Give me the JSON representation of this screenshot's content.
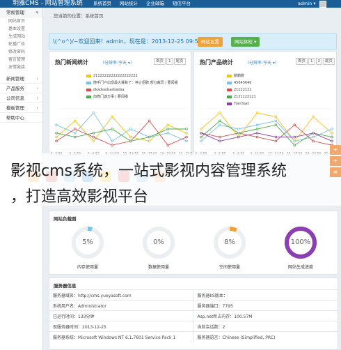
{
  "header": {
    "logo": "玥雅CMS - 网站管理系统",
    "nav": [
      "系统首页",
      "网站统计",
      "企业邮箱",
      "短信平台"
    ],
    "user": "admin ▾"
  },
  "sidebar": {
    "groups": [
      {
        "label": "常规管理",
        "active": true,
        "items": [
          "网站首页",
          "基本设置",
          "生成网站",
          "轮播广告",
          "修改密码",
          "留言管理",
          "友情链接"
        ]
      },
      {
        "label": "新闻管理"
      },
      {
        "label": "产品服务"
      },
      {
        "label": "公司信息"
      },
      {
        "label": "模板管理"
      },
      {
        "label": "帮助中心"
      }
    ]
  },
  "breadcrumb": "您当前的位置：系统首页",
  "welcome": {
    "text": "\\(^o^)/~欢迎回来！admin，现在是：2013-12-25 09:56",
    "settings_button": "网站设置",
    "check_button": "网站体检 ▾"
  },
  "news_panel": {
    "title": "热门新闻统计",
    "sub": "（分辨率:今天 ▾）",
    "pager": [
      "首页",
      "1",
      "尾页"
    ]
  },
  "product_panel": {
    "title": "热门产品统计",
    "sub": "（分辨率:今天 ▾）",
    "pager": [
      "首页",
      "1",
      "2",
      "尾页"
    ]
  },
  "chart_data": [
    {
      "type": "line",
      "categories": [
        "0~3:59",
        "3~5:59",
        "6~8:59",
        "9~11:59",
        "12~14:59",
        "15~17:59",
        "18~20:59",
        "21~23:59"
      ],
      "ylim": [
        0,
        10
      ],
      "series": [
        {
          "name": "21122222222222222222",
          "color": "#f0c419",
          "values": [
            3,
            7,
            2,
            8,
            3,
            2,
            6,
            4
          ]
        },
        {
          "name": "随手门户出现最大暴跌了：停止招聘 部分裁员 | 要闻播",
          "color": "#7cc0e8",
          "values": [
            6,
            4,
            9,
            2,
            5,
            3,
            4,
            2
          ]
        },
        {
          "name": "dkadsadsadsadsa",
          "color": "#d94b4b",
          "values": [
            2,
            5,
            3,
            1,
            2,
            7,
            1,
            3
          ]
        },
        {
          "name": "加微门诚万事 | 要闻播",
          "color": "#4aa84a",
          "values": [
            4,
            3,
            4,
            5,
            2,
            3,
            5,
            5
          ]
        }
      ]
    },
    {
      "type": "line",
      "categories": [
        "0~3:59",
        "3~5:59",
        "6~8:59",
        "9~11:59",
        "12~14:59",
        "15~17:59",
        "18~20:59",
        "21~23:59"
      ],
      "ylim": [
        0,
        10
      ],
      "series": [
        {
          "name": "鹏鹏鹏",
          "color": "#f0c419",
          "values": [
            5,
            9,
            3,
            9,
            8,
            2,
            8,
            4
          ]
        },
        {
          "name": "45645646",
          "color": "#7cc0e8",
          "values": [
            2,
            6,
            5,
            6,
            7,
            2,
            3,
            5
          ]
        },
        {
          "name": "21122121",
          "color": "#d94b4b",
          "values": [
            4,
            3,
            4,
            3,
            2,
            6,
            2,
            1
          ]
        },
        {
          "name": "2121122121",
          "color": "#4aa84a",
          "values": [
            3,
            7,
            4,
            5,
            6,
            1,
            4,
            3
          ]
        },
        {
          "name": "TianYuan",
          "color": "#8b3fb0",
          "values": [
            4,
            2,
            3,
            4,
            3,
            3,
            4,
            2
          ]
        }
      ]
    }
  ],
  "overlay": {
    "line1": "影视cms系统，一站式影视内容管理系统",
    "line2": "，打造高效影视平台"
  },
  "side_buttons": [
    "+",
    "+",
    "≡"
  ],
  "load": {
    "title": "网站负载图",
    "gauges": [
      {
        "value": "5%",
        "label": "内存使用量",
        "fraction": 0.05,
        "color": "#7cc0e8"
      },
      {
        "value": "0%",
        "label": "数据使用量",
        "fraction": 0,
        "color": "#7cc0e8"
      },
      {
        "value": "8%",
        "label": "空间使用量",
        "fraction": 0.08,
        "color": "#f0a23a"
      },
      {
        "value": "100%",
        "label": "网站生成进度",
        "fraction": 1,
        "color": "#8b3fb0"
      }
    ]
  },
  "info": {
    "title": "服务器信息",
    "rows": [
      [
        "服务器域名：http://cms.yueyasoft.com",
        "服务器IIS版本："
      ],
      [
        "系统用户名：Administrator",
        "服务器端口：7795"
      ],
      [
        "已运行时间：133分钟",
        "Asp.net所占内存：100.57M"
      ],
      [
        "现服务器时间：2013-12-25",
        "当前会话数：2"
      ],
      [
        "服务器系统：Microsoft Windows NT 6.1.7601 Service Pack 1",
        "服务器语言：Chinese (Simplified, PRC)"
      ]
    ]
  }
}
